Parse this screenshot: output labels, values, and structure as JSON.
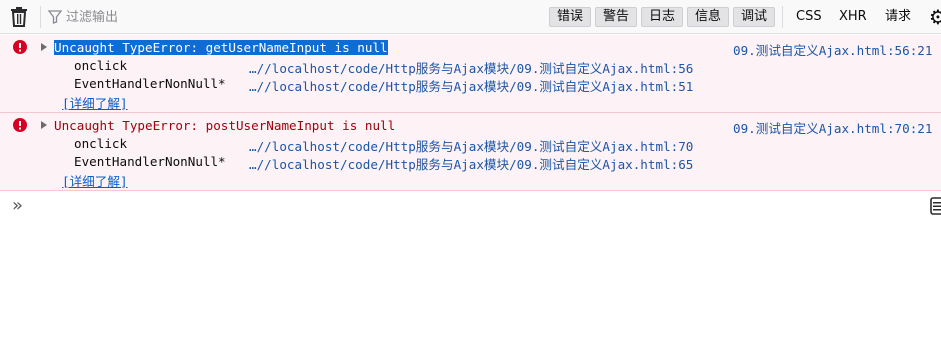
{
  "toolbar": {
    "clear_icon": "trash-icon",
    "filter_icon": "funnel-icon",
    "filter_placeholder": "过滤输出",
    "filter_value": "",
    "levels": [
      {
        "label": "错误",
        "active": true
      },
      {
        "label": "警告",
        "active": true
      },
      {
        "label": "日志",
        "active": true
      },
      {
        "label": "信息",
        "active": true
      },
      {
        "label": "调试",
        "active": true
      }
    ],
    "requests": [
      "CSS",
      "XHR",
      "请求"
    ],
    "settings_icon": "gear-icon"
  },
  "messages": [
    {
      "icon": "error-icon",
      "text": "Uncaught TypeError: getUserNameInput is null",
      "selected": true,
      "source": "09.测试自定义Ajax.html:56:21",
      "stack": [
        {
          "fn": "onclick",
          "location": "…//localhost/code/Http服务与Ajax模块/09.测试自定义Ajax.html:56"
        },
        {
          "fn": "EventHandlerNonNull*",
          "location": "…//localhost/code/Http服务与Ajax模块/09.测试自定义Ajax.html:51"
        }
      ],
      "learn_more": "[详细了解]"
    },
    {
      "icon": "error-icon",
      "text": "Uncaught TypeError: postUserNameInput is null",
      "selected": false,
      "source": "09.测试自定义Ajax.html:70:21",
      "stack": [
        {
          "fn": "onclick",
          "location": "…//localhost/code/Http服务与Ajax模块/09.测试自定义Ajax.html:70"
        },
        {
          "fn": "EventHandlerNonNull*",
          "location": "…//localhost/code/Http服务与Ajax模块/09.测试自定义Ajax.html:65"
        }
      ],
      "learn_more": "[详细了解]"
    }
  ],
  "input": {
    "prompt_icon": "chevrons-right-icon",
    "value": "",
    "split_icon": "split-console-icon"
  },
  "colors": {
    "toolbar_bg": "#f9f9fa",
    "error_bg": "#fdf2f5",
    "error_text": "#a4000f",
    "link": "#1b56a8",
    "selection": "#0f6cd3",
    "error_icon": "#d70022"
  }
}
